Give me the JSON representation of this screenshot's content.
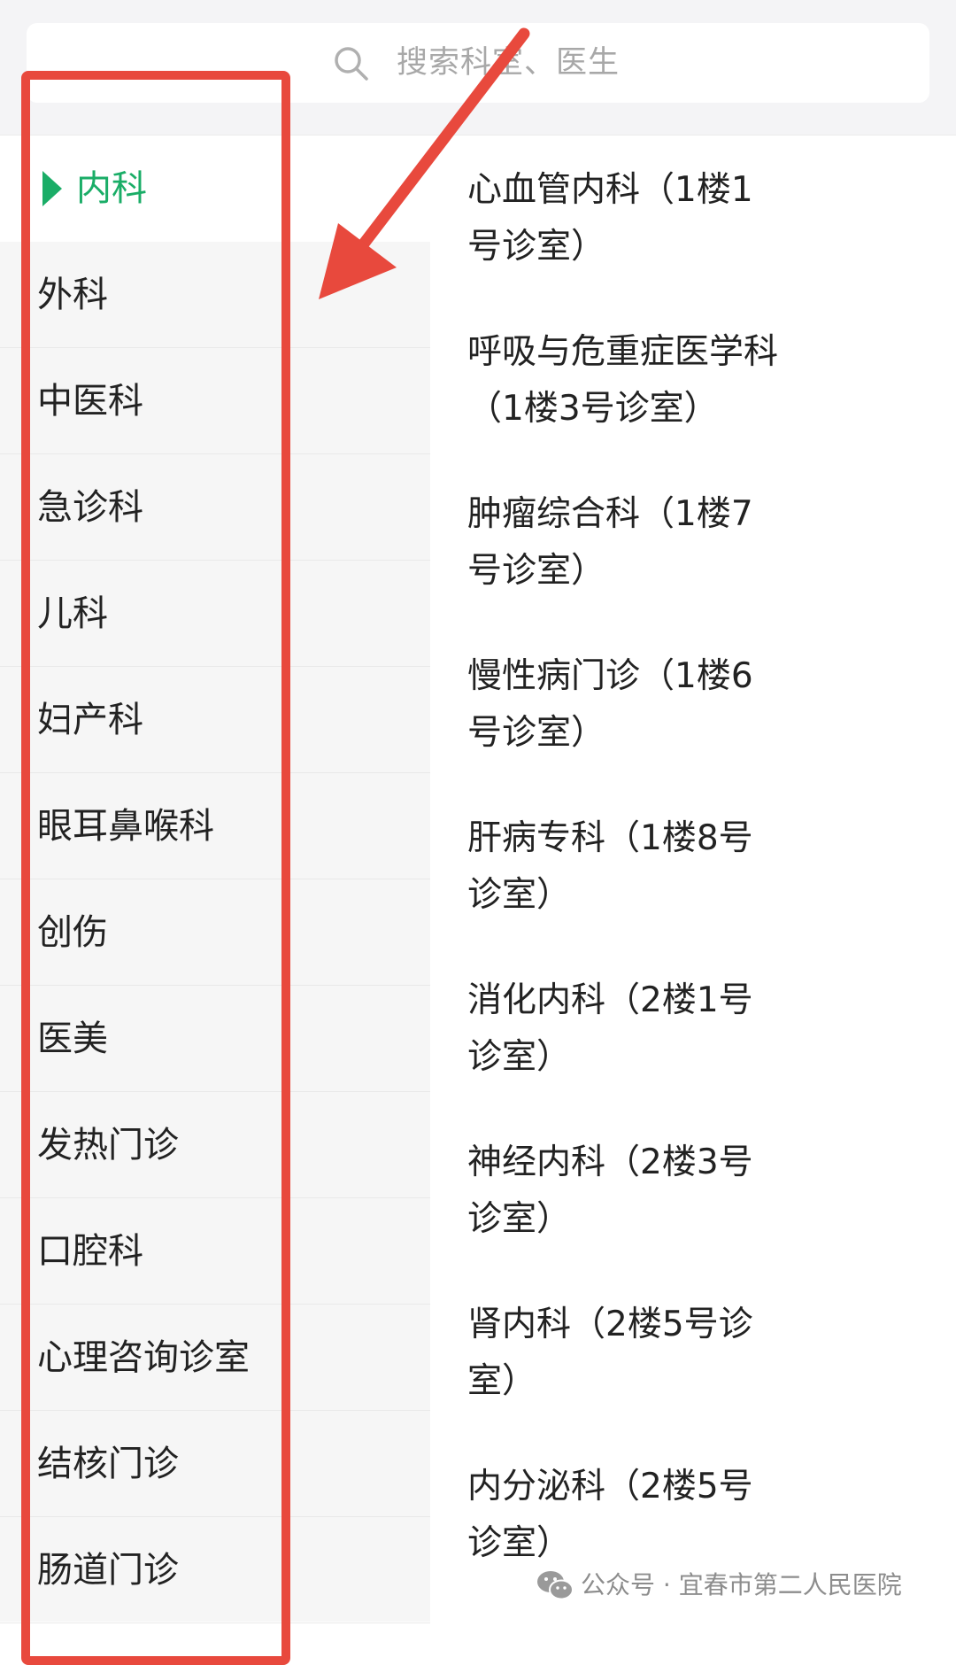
{
  "search": {
    "placeholder": "搜索科室、医生",
    "icon": "search-icon"
  },
  "sidebar": {
    "items": [
      {
        "label": "内科",
        "active": true
      },
      {
        "label": "外科"
      },
      {
        "label": "中医科"
      },
      {
        "label": "急诊科"
      },
      {
        "label": "儿科"
      },
      {
        "label": "妇产科"
      },
      {
        "label": "眼耳鼻喉科"
      },
      {
        "label": "创伤"
      },
      {
        "label": "医美"
      },
      {
        "label": "发热门诊"
      },
      {
        "label": "口腔科"
      },
      {
        "label": "心理咨询诊室"
      },
      {
        "label": "结核门诊"
      },
      {
        "label": "肠道门诊"
      }
    ]
  },
  "departments": [
    {
      "line1": "心血管内科（1楼1",
      "line2": "号诊室）"
    },
    {
      "line1": "呼吸与危重症医学科",
      "line2": "（1楼3号诊室）"
    },
    {
      "line1": "肿瘤综合科（1楼7",
      "line2": "号诊室）"
    },
    {
      "line1": "慢性病门诊（1楼6",
      "line2": "号诊室）"
    },
    {
      "line1": "肝病专科（1楼8号",
      "line2": "诊室）"
    },
    {
      "line1": "消化内科（2楼1号",
      "line2": "诊室）"
    },
    {
      "line1": "神经内科（2楼3号",
      "line2": "诊室）"
    },
    {
      "line1": "肾内科（2楼5号诊",
      "line2": "室）"
    },
    {
      "line1": "内分泌科（2楼5号",
      "line2": "诊室）"
    }
  ],
  "watermark": {
    "text": "公众号 · 宜春市第二人民医院",
    "icon": "wechat-icon"
  },
  "colors": {
    "accent": "#1aad67",
    "annotation": "#e8493d"
  }
}
